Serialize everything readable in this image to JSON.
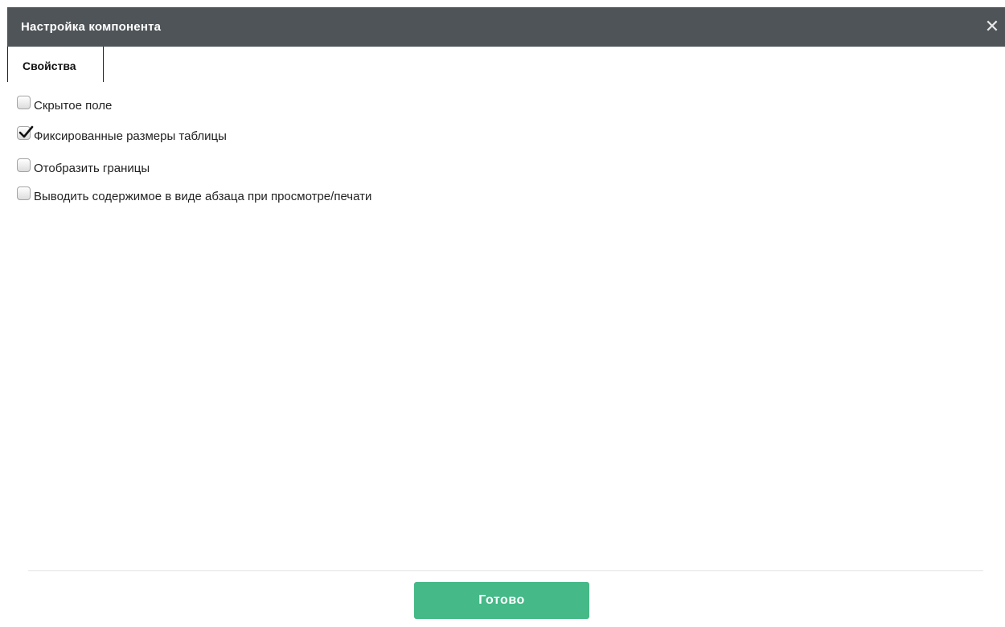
{
  "dialog": {
    "title": "Настройка компонента",
    "close_icon": "close-icon",
    "close_glyph": "✕"
  },
  "tabs": [
    {
      "label": "Свойства",
      "active": true
    }
  ],
  "options": [
    {
      "label": "Скрытое поле",
      "checked": false
    },
    {
      "label": "Фиксированные размеры таблицы",
      "checked": true
    },
    {
      "label": "Отобразить границы",
      "checked": false
    },
    {
      "label": "Выводить содержимое в виде абзаца при просмотре/печати",
      "checked": false
    }
  ],
  "footer": {
    "done_label": "Готово"
  },
  "colors": {
    "titlebar": "#4f5458",
    "done_button": "#45b987"
  }
}
